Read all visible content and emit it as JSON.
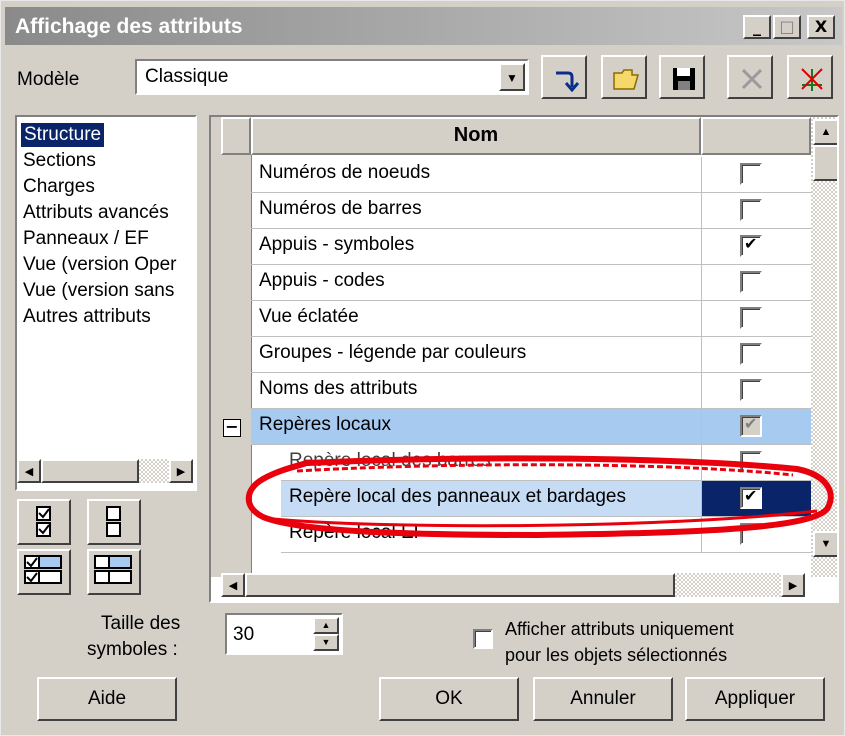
{
  "window": {
    "title": "Affichage des attributs",
    "controls": [
      "_",
      "□",
      "X"
    ]
  },
  "model": {
    "label": "Modèle",
    "value": "Classique"
  },
  "left_list": {
    "items": [
      {
        "label": "Structure",
        "selected": true
      },
      {
        "label": "Sections",
        "selected": false
      },
      {
        "label": "Charges",
        "selected": false
      },
      {
        "label": "Attributs avancés",
        "selected": false
      },
      {
        "label": "Panneaux / EF",
        "selected": false
      },
      {
        "label": "Vue (version Oper",
        "selected": false
      },
      {
        "label": "Vue (version sans",
        "selected": false
      },
      {
        "label": "Autres attributs",
        "selected": false
      }
    ]
  },
  "grid": {
    "column_header": "Nom",
    "rows": [
      {
        "label": "Numéros de noeuds",
        "checked": false
      },
      {
        "label": "Numéros de barres",
        "checked": false
      },
      {
        "label": "Appuis - symboles",
        "checked": true
      },
      {
        "label": "Appuis - codes",
        "checked": false
      },
      {
        "label": "Vue éclatée",
        "checked": false
      },
      {
        "label": "Groupes - légende par couleurs",
        "checked": false
      },
      {
        "label": "Noms des attributs",
        "checked": false
      },
      {
        "label": "Repères locaux",
        "checked": true,
        "collapse_sign": "−"
      },
      {
        "label": "Repère local des barres",
        "checked": false
      },
      {
        "label": "Repère local des panneaux et bardages",
        "checked": true
      },
      {
        "label": "Repère local EF",
        "checked": false
      }
    ]
  },
  "symbol_size": {
    "label_line1": "Taille des",
    "label_line2": "symboles :",
    "value": "30"
  },
  "selected_only": {
    "label_line1": "Afficher attributs uniquement",
    "label_line2": "pour les objets sélectionnés",
    "checked": false
  },
  "buttons": {
    "help": "Aide",
    "ok": "OK",
    "cancel": "Annuler",
    "apply": "Appliquer"
  },
  "colors": {
    "selection": "#0a246a",
    "group_highlight": "#a6caf0",
    "row_highlight": "#c6dcf4",
    "annotation_red": "#e8000c"
  }
}
